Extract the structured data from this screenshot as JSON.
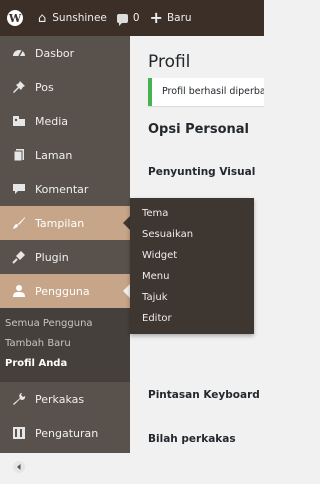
{
  "adminbar": {
    "site_name": "Sunshinee",
    "comment_count": "0",
    "new_label": "Baru"
  },
  "sidebar": {
    "items": [
      {
        "label": "Dasbor",
        "icon": "dashboard-icon"
      },
      {
        "label": "Pos",
        "icon": "pin-icon"
      },
      {
        "label": "Media",
        "icon": "media-icon"
      },
      {
        "label": "Laman",
        "icon": "page-icon"
      },
      {
        "label": "Komentar",
        "icon": "comment-icon"
      },
      {
        "label": "Tampilan",
        "icon": "appearance-icon"
      },
      {
        "label": "Plugin",
        "icon": "plugin-icon"
      },
      {
        "label": "Pengguna",
        "icon": "users-icon"
      }
    ],
    "users_submenu": [
      "Semua Pengguna",
      "Tambah Baru",
      "Profil Anda"
    ],
    "bottom_items": [
      {
        "label": "Perkakas",
        "icon": "tools-icon"
      },
      {
        "label": "Pengaturan",
        "icon": "settings-icon"
      },
      {
        "label": "Persempit menu",
        "icon": "collapse-icon"
      }
    ]
  },
  "flyout": {
    "items": [
      "Tema",
      "Sesuaikan",
      "Widget",
      "Menu",
      "Tajuk",
      "Editor"
    ]
  },
  "main": {
    "title": "Profil",
    "notice": "Profil berhasil diperbarui.",
    "section_title": "Opsi Personal",
    "labels": {
      "visual_editor": "Penyunting Visual",
      "keyboard_shortcuts": "Pintasan Keyboard",
      "toolbar": "Bilah perkakas"
    }
  },
  "colors": {
    "adminbar_bg": "#3b2f27",
    "sidebar_bg": "#59524c",
    "highlight": "#c7a589",
    "notice_border": "#46b450"
  }
}
